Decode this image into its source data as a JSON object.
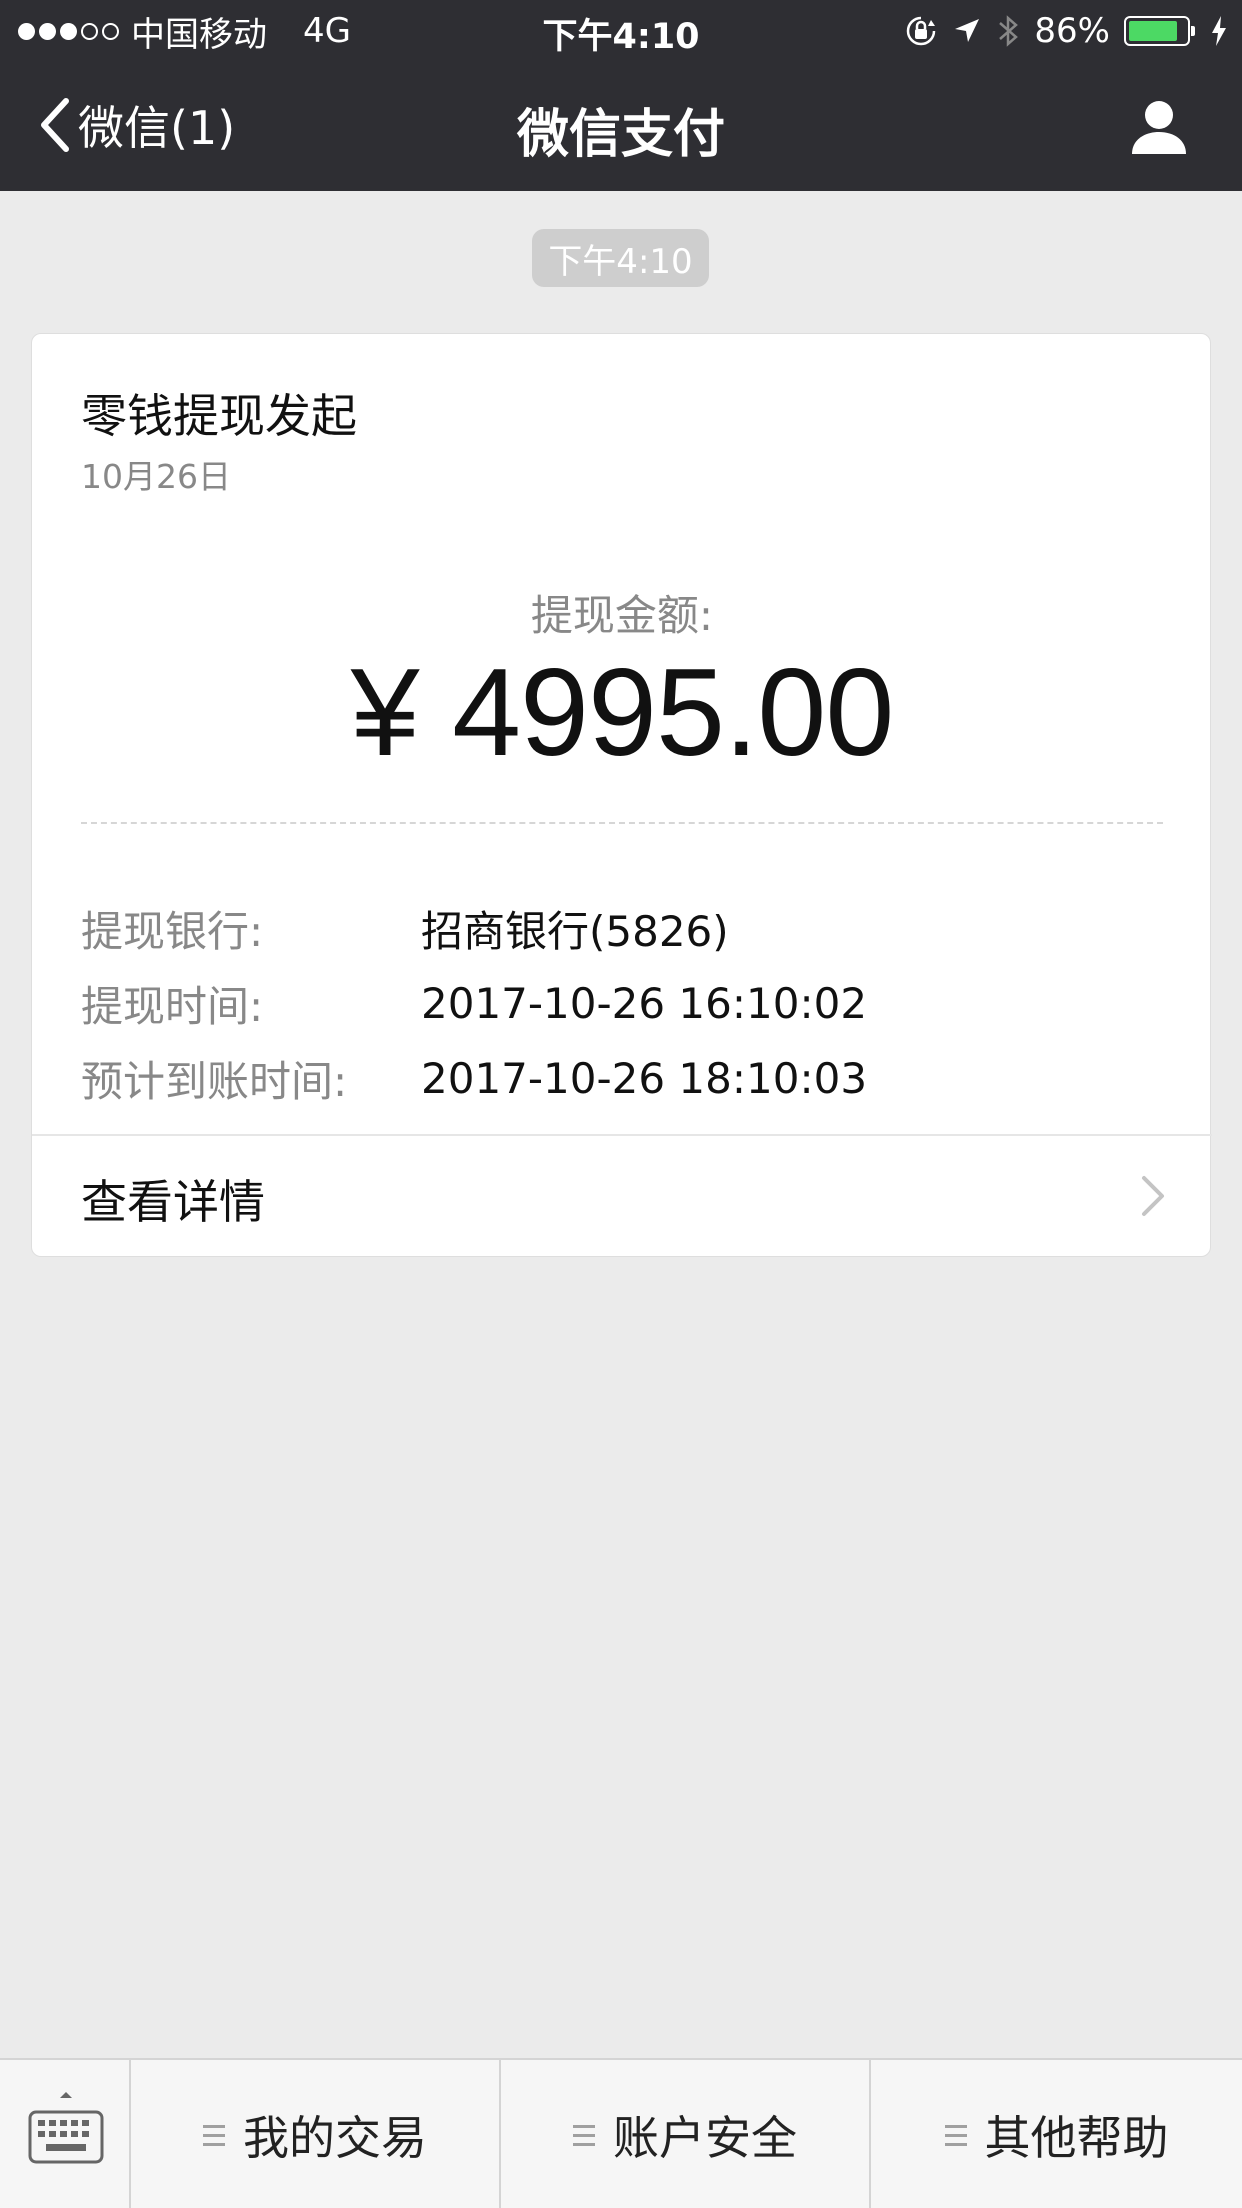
{
  "status_bar": {
    "carrier": "中国移动",
    "network": "4G",
    "time": "下午4:10",
    "battery_percent": "86%",
    "battery_level": 0.86,
    "colors": {
      "battery": "#4cd964"
    },
    "icons": [
      "signal-dots-icon",
      "orientation-lock-icon",
      "location-arrow-icon",
      "bluetooth-icon",
      "battery-icon",
      "charging-bolt-icon"
    ]
  },
  "navbar": {
    "back_label": "微信(1)",
    "title": "微信支付",
    "icons": [
      "back-chevron-icon",
      "user-profile-icon"
    ]
  },
  "message": {
    "timestamp": "下午4:10",
    "card": {
      "title": "零钱提现发起",
      "date": "10月26日",
      "amount_label": "提现金额:",
      "amount": "¥ 4995.00",
      "details": [
        {
          "label": "提现银行:",
          "value": "招商银行(5826)"
        },
        {
          "label": "提现时间:",
          "value": "2017-10-26 16:10:02"
        },
        {
          "label": "预计到账时间:",
          "value": "2017-10-26 18:10:03"
        }
      ],
      "link_label": "查看详情"
    }
  },
  "bottom_menu": {
    "keyboard_icon": "keyboard-icon",
    "items": [
      {
        "label": "我的交易"
      },
      {
        "label": "账户安全"
      },
      {
        "label": "其他帮助"
      }
    ]
  },
  "colors": {
    "header_bg": "#2e2e33",
    "page_bg": "#ebebeb",
    "card_bg": "#ffffff",
    "muted_text": "#888888"
  }
}
